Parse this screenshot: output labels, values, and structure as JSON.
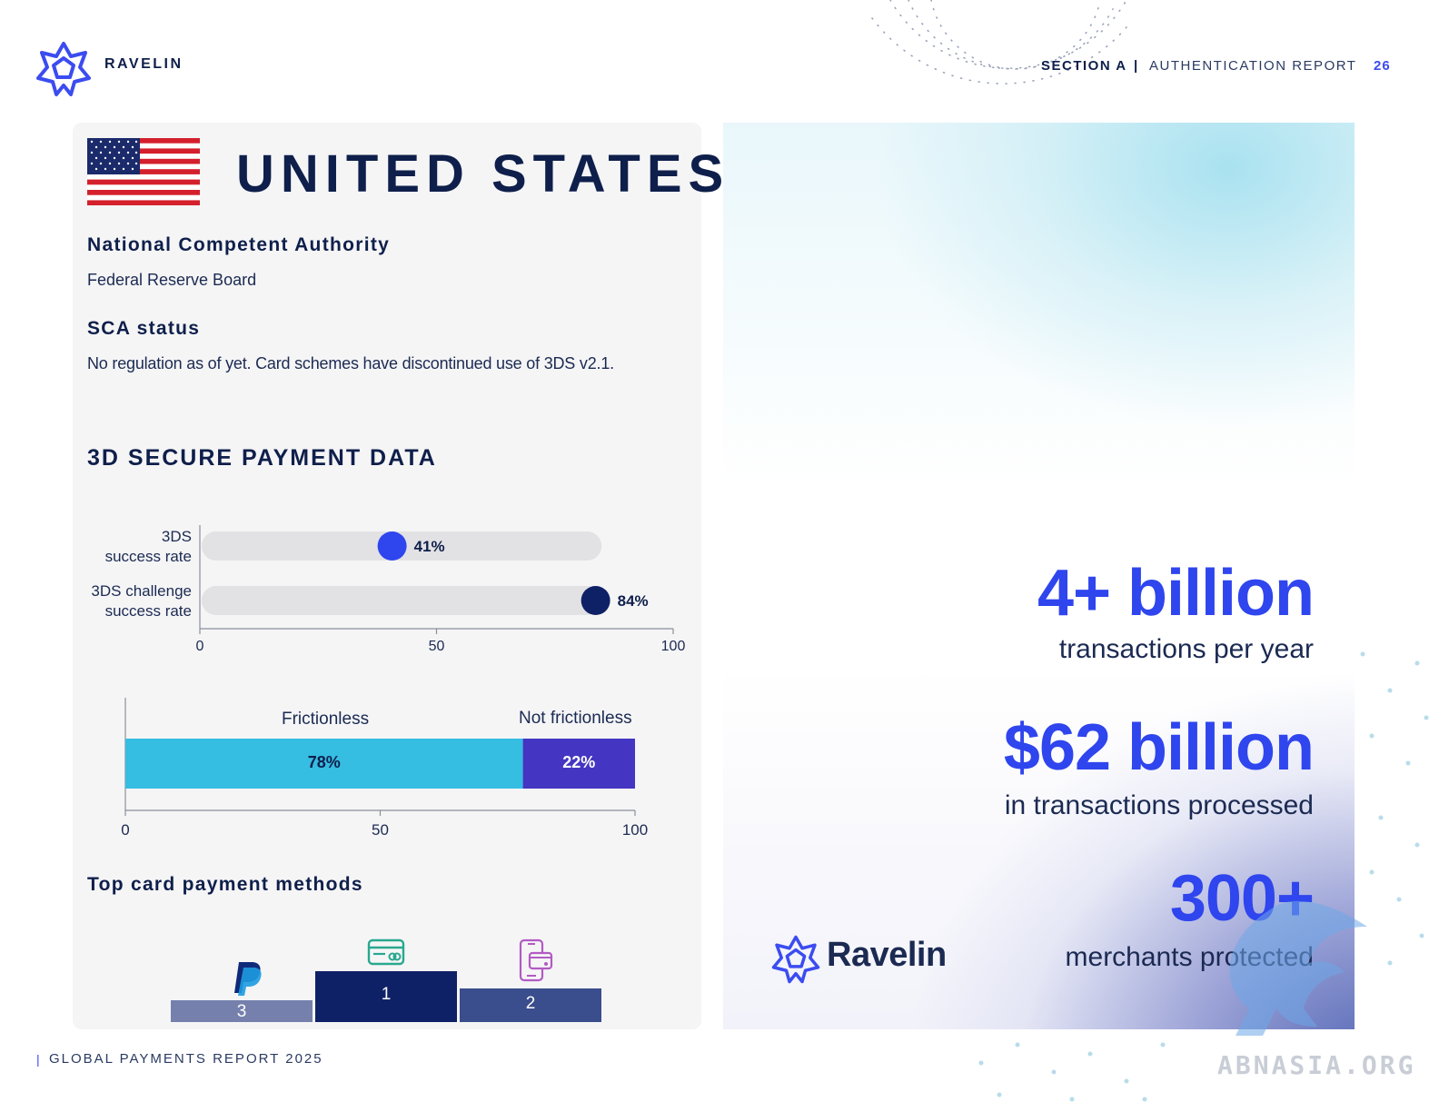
{
  "header": {
    "brand": "RAVELIN",
    "section": "SECTION A",
    "separator": "|",
    "report": "AUTHENTICATION REPORT",
    "page_number": "26"
  },
  "country": {
    "title": "UNITED STATES",
    "flag_icon": "us-flag-icon"
  },
  "nca": {
    "heading": "National Competent Authority",
    "value": "Federal Reserve Board"
  },
  "sca": {
    "heading": "SCA status",
    "value": "No regulation as of yet. Card schemes have discontinued use of 3DS v2.1."
  },
  "data_heading": "3D SECURE PAYMENT DATA",
  "chart_data": [
    {
      "type": "bar",
      "orientation": "horizontal",
      "categories": [
        "3DS success rate",
        "3DS challenge success rate"
      ],
      "category_lines": [
        [
          "3DS",
          "success rate"
        ],
        [
          "3DS challenge",
          "success rate"
        ]
      ],
      "values": [
        41,
        84
      ],
      "value_labels": [
        "41%",
        "84%"
      ],
      "colors": [
        "#2f45ee",
        "#0f2166"
      ],
      "xlim": [
        0,
        100
      ],
      "xticks": [
        "0",
        "50",
        "100"
      ]
    },
    {
      "type": "bar",
      "orientation": "horizontal-stacked",
      "series": [
        {
          "name": "Frictionless",
          "value": 78,
          "label": "78%",
          "color": "#35bde2"
        },
        {
          "name": "Not frictionless",
          "value": 22,
          "label": "22%",
          "color": "#4436c2"
        }
      ],
      "xlim": [
        0,
        100
      ],
      "xticks": [
        "0",
        "50",
        "100"
      ]
    }
  ],
  "methods": {
    "heading": "Top card payment methods",
    "items": [
      {
        "rank": "3",
        "icon": "paypal-icon",
        "color": "#7580ad"
      },
      {
        "rank": "1",
        "icon": "credit-card-icon",
        "color": "#0f2166"
      },
      {
        "rank": "2",
        "icon": "mobile-wallet-icon",
        "color": "#3a4d8c"
      }
    ]
  },
  "stats": [
    {
      "big": "4+ billion",
      "sub": "transactions per year"
    },
    {
      "big": "$62 billion",
      "sub": "in transactions processed"
    },
    {
      "big": "300+",
      "sub": "merchants protected"
    }
  ],
  "panel_brand": "Ravelin",
  "footer": {
    "bar": "|",
    "text": "GLOBAL PAYMENTS REPORT 2025"
  },
  "watermark": "ABNASIA.ORG",
  "colors": {
    "accent": "#2f45ee",
    "navy": "#0f1f4b",
    "frictionless": "#35bde2",
    "not_frictionless": "#4436c2"
  }
}
